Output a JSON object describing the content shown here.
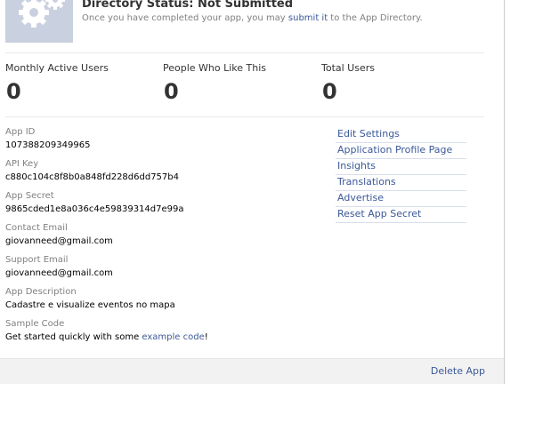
{
  "directory": {
    "status_title": "Directory Status: Not Submitted",
    "desc_before": "Once you have completed your app, you may ",
    "desc_link": "submit it",
    "desc_after": " to the App Directory."
  },
  "stats": [
    {
      "label": "Monthly Active Users",
      "value": "0"
    },
    {
      "label": "People Who Like This",
      "value": "0"
    },
    {
      "label": "Total Users",
      "value": "0"
    }
  ],
  "fields": {
    "app_id": {
      "label": "App ID",
      "value": "107388209349965"
    },
    "api_key": {
      "label": "API Key",
      "value": "c880c104c8f8b0a848fd228d6dd757b4"
    },
    "app_secret": {
      "label": "App Secret",
      "value": "9865cded1e8a036c4e59839314d7e99a"
    },
    "contact_email": {
      "label": "Contact Email",
      "value": "giovanneed@gmail.com"
    },
    "support_email": {
      "label": "Support Email",
      "value": "giovanneed@gmail.com"
    },
    "app_description": {
      "label": "App Description",
      "value": "Cadastre e visualize eventos no mapa"
    },
    "sample_code": {
      "label": "Sample Code",
      "value_before": "Get started quickly with some ",
      "value_link": "example code",
      "value_after": "!"
    }
  },
  "links": [
    "Edit Settings",
    "Application Profile Page",
    "Insights",
    "Translations",
    "Advertise",
    "Reset App Secret"
  ],
  "footer": {
    "delete_label": "Delete App"
  },
  "colors": {
    "link": "#3b5998",
    "label_gray": "#808080",
    "icon_bg": "#c9d0df",
    "footer_bg": "#f2f2f2"
  },
  "icons": {
    "app_icon": "gear-icon"
  }
}
